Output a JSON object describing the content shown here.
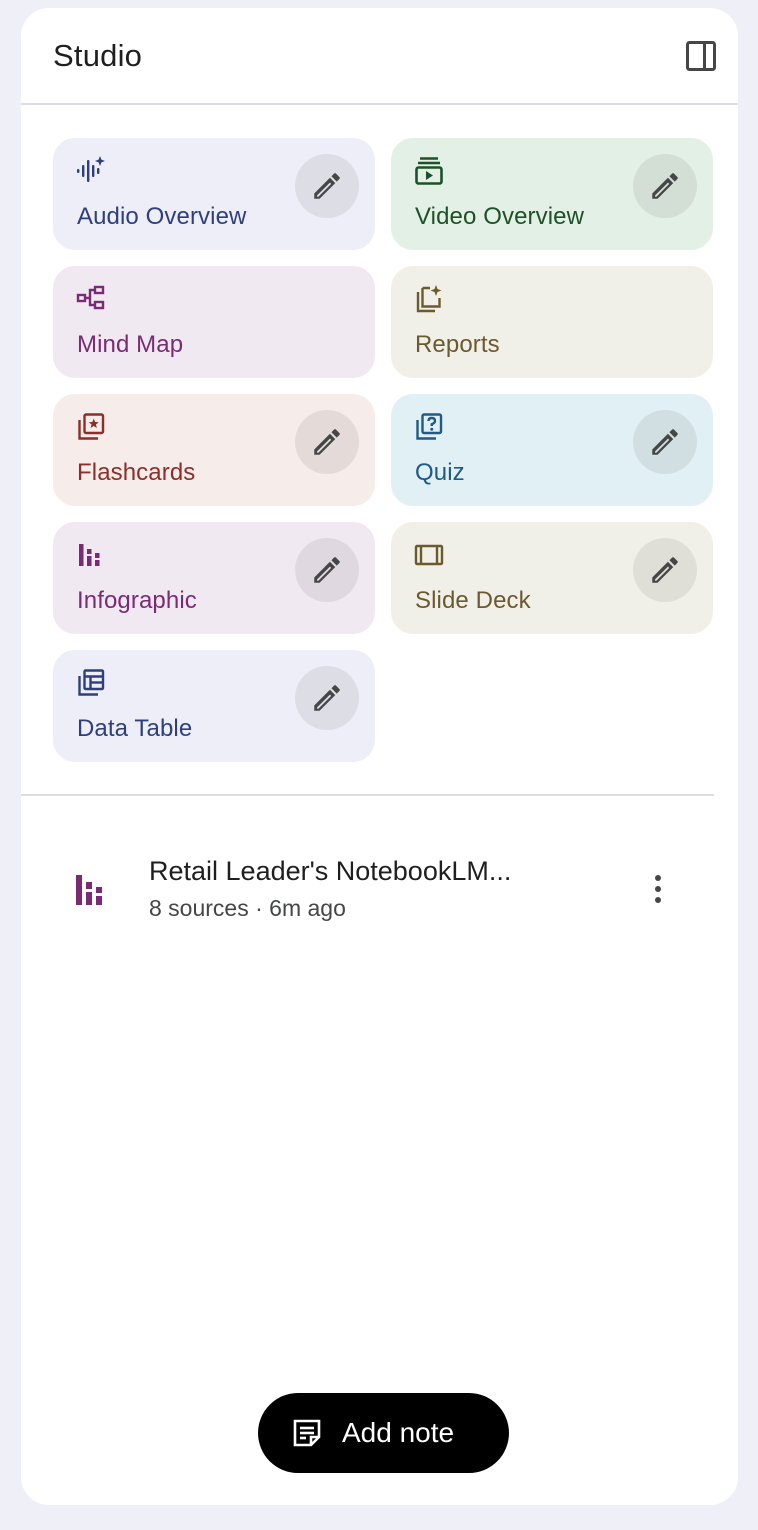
{
  "header": {
    "title": "Studio",
    "toggle_icon": "side-panel-icon"
  },
  "tiles": [
    {
      "label": "Audio Overview",
      "icon": "audio-waveform-sparkle-icon",
      "bg": "#eeeef8",
      "fg": "#2e3f7c",
      "has_edit": true
    },
    {
      "label": "Video Overview",
      "icon": "video-play-stack-icon",
      "bg": "#e3f0e5",
      "fg": "#1e5128",
      "has_edit": true
    },
    {
      "label": "Mind Map",
      "icon": "mind-map-icon",
      "bg": "#f1e9f1",
      "fg": "#7b2a75",
      "has_edit": false
    },
    {
      "label": "Reports",
      "icon": "report-sparkle-icon",
      "bg": "#f1f0e8",
      "fg": "#6c5a2f",
      "has_edit": false
    },
    {
      "label": "Flashcards",
      "icon": "flashcards-star-icon",
      "bg": "#f6ecea",
      "fg": "#8a2f2a",
      "has_edit": true
    },
    {
      "label": "Quiz",
      "icon": "quiz-question-icon",
      "bg": "#e1f0f5",
      "fg": "#1f5a84",
      "has_edit": true
    },
    {
      "label": "Infographic",
      "icon": "infographic-bars-icon",
      "bg": "#f1e9f1",
      "fg": "#7b2a75",
      "has_edit": true
    },
    {
      "label": "Slide Deck",
      "icon": "slide-deck-icon",
      "bg": "#f1f0e8",
      "fg": "#6c5a2f",
      "has_edit": true
    },
    {
      "label": "Data Table",
      "icon": "data-table-icon",
      "bg": "#eeeef8",
      "fg": "#2e3f7c",
      "has_edit": true
    }
  ],
  "notes": [
    {
      "title": "Retail Leader's NotebookLM...",
      "meta": "8 sources · 6m ago",
      "icon": "infographic-bars-icon",
      "icon_color": "#7b2a75"
    }
  ],
  "add_note": {
    "label": "Add note",
    "icon": "note-icon"
  },
  "colors": {
    "edit_button_bg": "rgba(0,0,0,0.07)",
    "pencil": "#444746"
  }
}
